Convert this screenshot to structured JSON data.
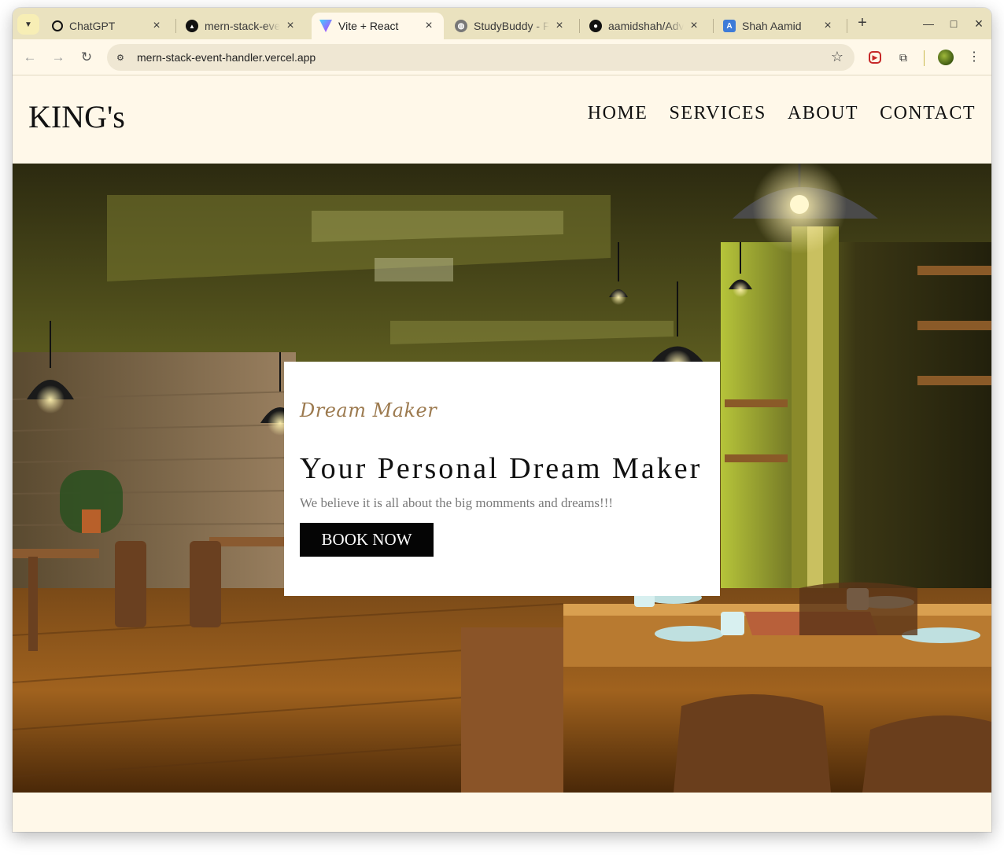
{
  "browser": {
    "tabs": [
      {
        "title": "ChatGPT",
        "icon": "chatgpt-icon"
      },
      {
        "title": "mern-stack-event-handler",
        "icon": "vercel-icon"
      },
      {
        "title": "Vite + React",
        "icon": "vite-icon",
        "active": true
      },
      {
        "title": "StudyBuddy - Find",
        "icon": "globe-icon"
      },
      {
        "title": "aamidshah/Advanced",
        "icon": "github-icon"
      },
      {
        "title": "Shah Aamid",
        "icon": "letter-a-icon"
      }
    ],
    "url": "mern-stack-event-handler.vercel.app"
  },
  "site": {
    "logo": "KING's",
    "nav": [
      "HOME",
      "SERVICES",
      "ABOUT",
      "CONTACT"
    ],
    "hero": {
      "kicker": "Dream Maker",
      "title": "Your Personal Dream Maker",
      "subtitle": "We believe it is all about the big momments and dreams!!!",
      "button": "BOOK NOW"
    }
  },
  "colors": {
    "page_background": "#fff8e9",
    "tabstrip": "#eae2bf",
    "kicker": "#9c7a4f",
    "button": "#050505"
  }
}
